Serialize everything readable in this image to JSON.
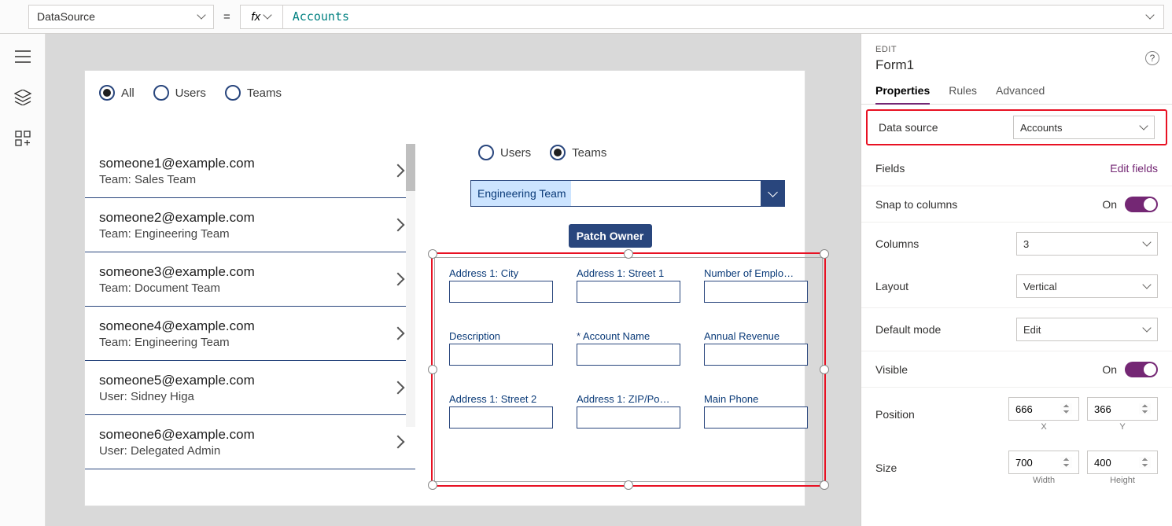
{
  "formula_bar": {
    "property": "DataSource",
    "value": "Accounts"
  },
  "canvas": {
    "filter_radios": [
      {
        "label": "All",
        "selected": true
      },
      {
        "label": "Users",
        "selected": false
      },
      {
        "label": "Teams",
        "selected": false
      }
    ],
    "gallery": [
      {
        "email": "someone1@example.com",
        "sub": "Team: Sales Team"
      },
      {
        "email": "someone2@example.com",
        "sub": "Team: Engineering Team"
      },
      {
        "email": "someone3@example.com",
        "sub": "Team: Document Team"
      },
      {
        "email": "someone4@example.com",
        "sub": "Team: Engineering Team"
      },
      {
        "email": "someone5@example.com",
        "sub": "User: Sidney Higa"
      },
      {
        "email": "someone6@example.com",
        "sub": "User: Delegated Admin"
      }
    ],
    "owner_radios": [
      {
        "label": "Users",
        "selected": false
      },
      {
        "label": "Teams",
        "selected": true
      }
    ],
    "team_dropdown": "Engineering Team",
    "patch_button": "Patch Owner",
    "form_fields": [
      {
        "label": "Address 1: City",
        "required": false
      },
      {
        "label": "Address 1: Street 1",
        "required": false
      },
      {
        "label": "Number of Emplo…",
        "required": false
      },
      {
        "label": "Description",
        "required": false
      },
      {
        "label": "Account Name",
        "required": true
      },
      {
        "label": "Annual Revenue",
        "required": false
      },
      {
        "label": "Address 1: Street 2",
        "required": false
      },
      {
        "label": "Address 1: ZIP/Po…",
        "required": false
      },
      {
        "label": "Main Phone",
        "required": false
      }
    ]
  },
  "props": {
    "edit_label": "EDIT",
    "control_name": "Form1",
    "tabs": {
      "properties": "Properties",
      "rules": "Rules",
      "advanced": "Advanced"
    },
    "data_source": {
      "label": "Data source",
      "value": "Accounts"
    },
    "fields": {
      "label": "Fields",
      "link": "Edit fields"
    },
    "snap": {
      "label": "Snap to columns",
      "value": "On"
    },
    "columns": {
      "label": "Columns",
      "value": "3"
    },
    "layout": {
      "label": "Layout",
      "value": "Vertical"
    },
    "default_mode": {
      "label": "Default mode",
      "value": "Edit"
    },
    "visible": {
      "label": "Visible",
      "value": "On"
    },
    "position": {
      "label": "Position",
      "x": "666",
      "y": "366",
      "x_label": "X",
      "y_label": "Y"
    },
    "size": {
      "label": "Size",
      "w": "700",
      "h": "400",
      "w_label": "Width",
      "h_label": "Height"
    }
  }
}
